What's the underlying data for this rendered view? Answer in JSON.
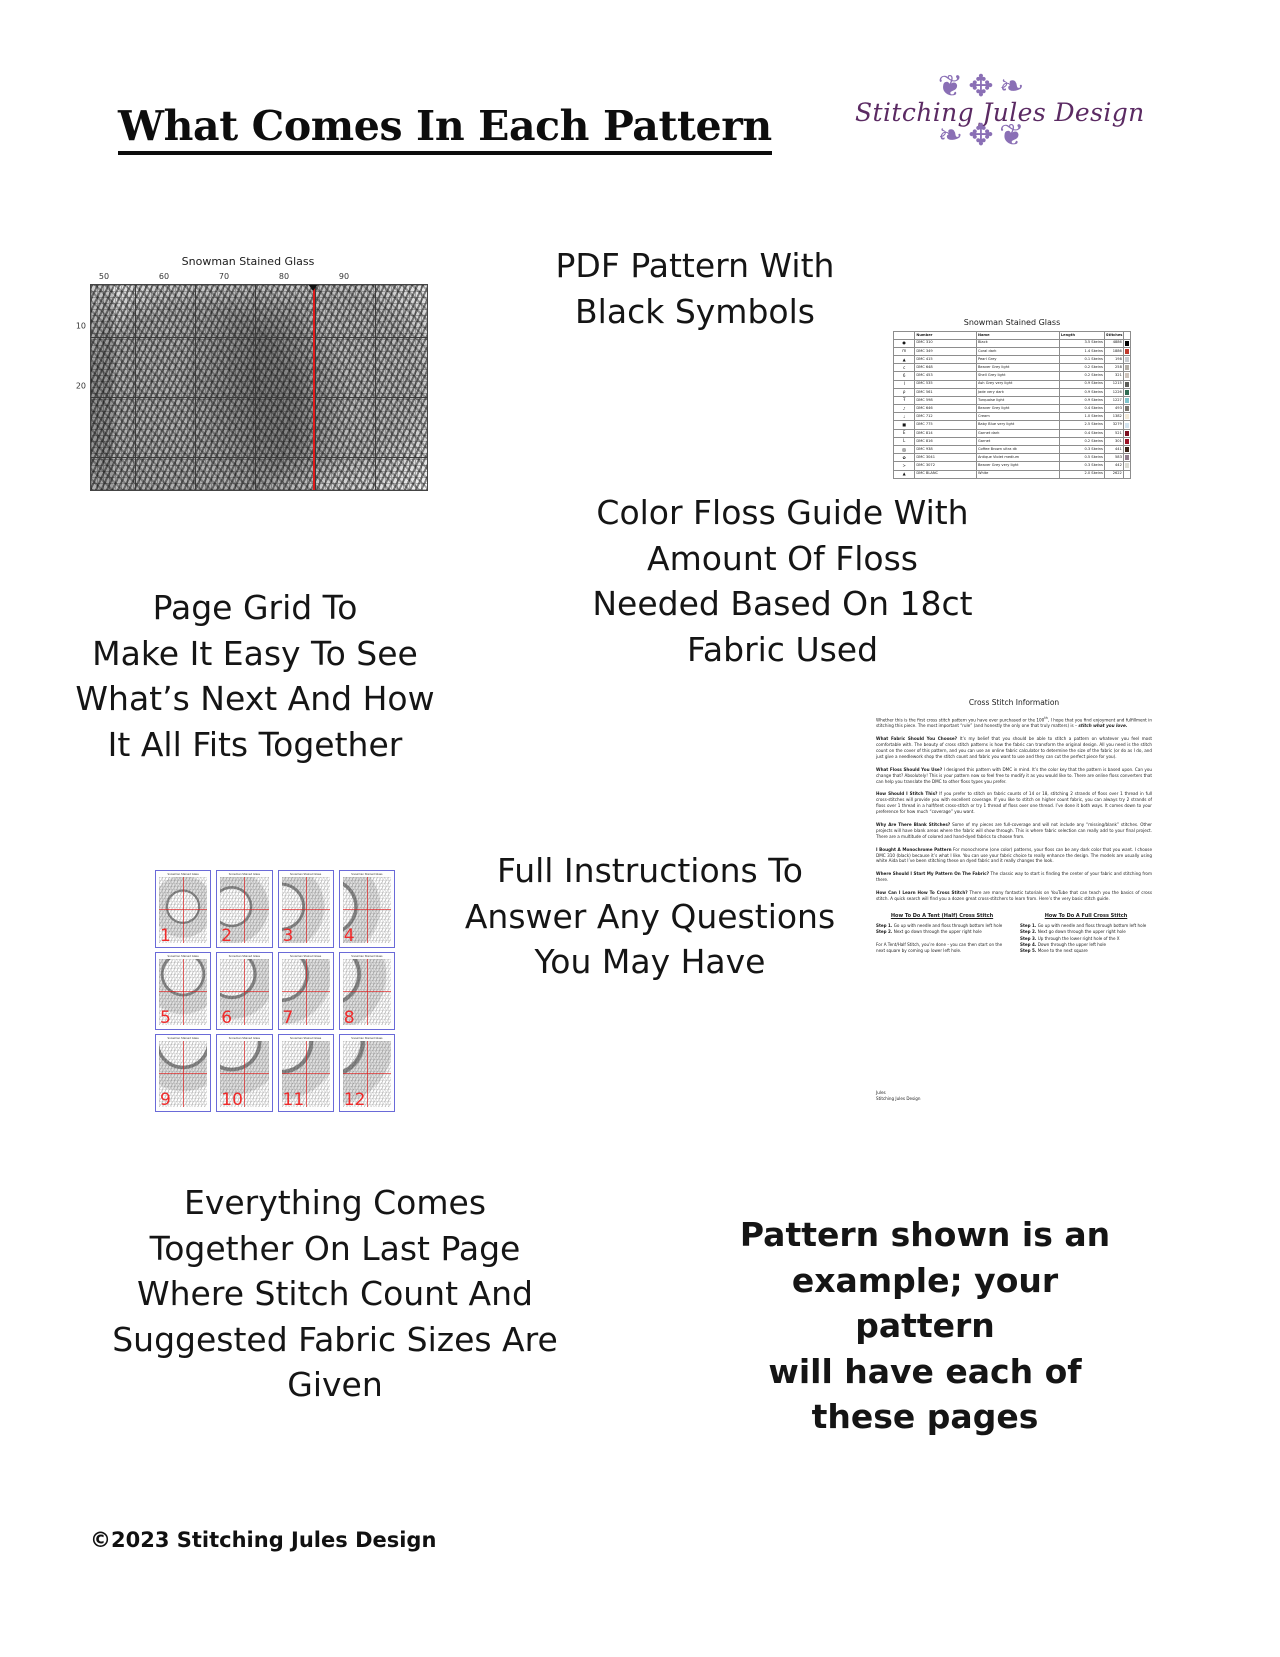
{
  "header": {
    "title": "What Comes In Each Pattern",
    "logo": {
      "brand": "Stitching Jules Design",
      "flourish_top": "❦ ✥ ❧",
      "flourish_bottom": "❧ ✥ ❦",
      "accent_color": "#8a6fb5",
      "text_color": "#5b2a63"
    }
  },
  "blurbs": {
    "pdf_pattern": "PDF Pattern With\nBlack Symbols",
    "page_grid": "Page Grid To\nMake It Easy To See\nWhat’s Next And How\nIt All Fits Together",
    "color_floss": "Color Floss Guide With\nAmount Of Floss\nNeeded Based On 18ct\nFabric Used",
    "full_instructions": "Full Instructions To\nAnswer Any Questions\nYou May Have",
    "everything_comes": "Everything Comes\nTogether On Last Page\nWhere Stitch Count And\nSuggested Fabric Sizes Are\nGiven",
    "example_note": "Pattern shown is an\nexample; your pattern\nwill have each of\nthese pages"
  },
  "footer": {
    "copyright": "©2023 Stitching Jules Design"
  },
  "chart_data": {
    "type": "heatmap",
    "title": "Snowman Stained Glass",
    "xlabel": "",
    "ylabel": "",
    "x_ticks": [
      50,
      60,
      70,
      80,
      90
    ],
    "y_ticks": [
      10,
      20
    ],
    "grid": true,
    "centerline_color": "#e01b1b",
    "centerline_x": 80,
    "description": "Cross stitch chart grid of black symbols on white squares with heavy grid lines every 10 stitches and a red vertical center guideline marked by a black arrow at column 80."
  },
  "floss_guide": {
    "title": "Snowman Stained Glass",
    "columns": [
      "",
      "Number",
      "Name",
      "Length",
      "Stitches",
      ""
    ],
    "rows": [
      {
        "symbol": "●",
        "number": "DMC   310",
        "name": "Black",
        "length": "3.5 Skeins",
        "stitches": "4886",
        "swatch": "#000000"
      },
      {
        "symbol": "m",
        "number": "DMC   349",
        "name": "Coral dark",
        "length": "1.4 Skeins",
        "stitches": "1886",
        "swatch": "#c0392b"
      },
      {
        "symbol": "▲",
        "number": "DMC   415",
        "name": "Pearl Grey",
        "length": "0.1 Skeins",
        "stitches": "198",
        "swatch": "#c9ccd0"
      },
      {
        "symbol": "c",
        "number": "DMC   648",
        "name": "Beaver Grey light",
        "length": "0.2 Skeins",
        "stitches": "258",
        "swatch": "#b4aea6"
      },
      {
        "symbol": "6",
        "number": "DMC   453",
        "name": "Shell Grey light",
        "length": "0.2 Skeins",
        "stitches": "321",
        "swatch": "#cdc3bb"
      },
      {
        "symbol": "I",
        "number": "DMC   535",
        "name": "Ash Grey very light",
        "length": "0.9 Skeins",
        "stitches": "1215",
        "swatch": "#5c5d58"
      },
      {
        "symbol": "ρ",
        "number": "DMC   561",
        "name": "Jade very dark",
        "length": "0.9 Skeins",
        "stitches": "1226",
        "swatch": "#2f6b52"
      },
      {
        "symbol": "Ŧ",
        "number": "DMC   598",
        "name": "Turquoise light",
        "length": "0.9 Skeins",
        "stitches": "1227",
        "swatch": "#7fc5cd"
      },
      {
        "symbol": "♪",
        "number": "DMC   646",
        "name": "Beaver Grey light",
        "length": "0.4 Skeins",
        "stitches": "493",
        "swatch": "#7a766e"
      },
      {
        "symbol": "♩",
        "number": "DMC   712",
        "name": "Cream",
        "length": "1.0 Skeins",
        "stitches": "1382",
        "swatch": "#f3ead8"
      },
      {
        "symbol": "■",
        "number": "DMC   775",
        "name": "Baby Blue very light",
        "length": "2.5 Skeins",
        "stitches": "3279",
        "swatch": "#d3e4f0"
      },
      {
        "symbol": "E",
        "number": "DMC   814",
        "name": "Garnet dark",
        "length": "0.4 Skeins",
        "stitches": "521",
        "swatch": "#7c0d1e"
      },
      {
        "symbol": "L",
        "number": "DMC   816",
        "name": "Garnet",
        "length": "0.2 Skeins",
        "stitches": "301",
        "swatch": "#9b1024"
      },
      {
        "symbol": "▨",
        "number": "DMC   938",
        "name": "Coffee Brown ultra dk",
        "length": "0.3 Skeins",
        "stitches": "441",
        "swatch": "#3b2418"
      },
      {
        "symbol": "✿",
        "number": "DMC   3041",
        "name": "Antique Violet medium",
        "length": "0.5 Skeins",
        "stitches": "583",
        "swatch": "#8f7c8c"
      },
      {
        "symbol": ">",
        "number": "DMC   3072",
        "name": "Beaver Grey very light",
        "length": "0.3 Skeins",
        "stitches": "442",
        "swatch": "#dcdcd4"
      },
      {
        "symbol": "▲",
        "number": "DMC   BLANC",
        "name": "White",
        "length": "2.0 Skeins",
        "stitches": "2622",
        "swatch": "#ffffff"
      }
    ]
  },
  "page_grid": {
    "thumbnail_title": "Snowman Stained Glass",
    "thumbnails": [
      {
        "number": "1"
      },
      {
        "number": "2"
      },
      {
        "number": "3"
      },
      {
        "number": "4"
      },
      {
        "number": "5"
      },
      {
        "number": "6"
      },
      {
        "number": "7"
      },
      {
        "number": "8"
      },
      {
        "number": "9"
      },
      {
        "number": "10"
      },
      {
        "number": "11"
      },
      {
        "number": "12"
      }
    ],
    "border_color": "#6a6ad8",
    "number_color": "#ef2b2b"
  },
  "instructions": {
    "title": "Cross Stitch Information",
    "intro_lead": "Whether this is the first cross stitch pattern you have ever purchased or the 100",
    "intro_rest": ", I hope that you find enjoyment and fulfillment in stitching this piece. The most important “rule” (and honestly the only one that truly matters) is – ",
    "intro_emphasis": "stitch what you love.",
    "sections": [
      {
        "heading": "What Fabric Should You Choose?",
        "body": " It’s my belief that you should be able to stitch a pattern on whatever you feel most comfortable with. The beauty of cross stitch patterns is how the fabric can transform the original design. All you need is the stitch count on the cover of this pattern, and you can use an online fabric calculator to determine the size of the fabric (or do as I do, and just give a needlework shop the stitch count and fabric you want to use and they can cut the perfect piece for you)."
      },
      {
        "heading": "What Floss Should You Use?",
        "body": " I designed this pattern with DMC in mind. It’s the color key that the pattern is based upon. Can you change that? Absolutely! This is your pattern now so feel free to modify it as you would like to.  There are online floss converters that can help you translate the DMC to other floss types you prefer."
      },
      {
        "heading": "How Should I Stitch This?",
        "body": " If you prefer to stitch on fabric counts of 14 or 18, stitching 2 strands of floss over 1 thread in full cross-stitches will provide you with excellent coverage. If you like to stitch on higher count fabric, you can always try 2 strands of floss over 1 thread in a half/tent cross-stitch or try 1 thread of floss over one thread. I’ve done it both ways. It comes down to your preference for how much “coverage” you want."
      },
      {
        "heading": "Why Are There Blank Stitches?",
        "body": " Some of my pieces are full-coverage and will not include any “missing/blank” stitches. Other projects will have blank areas where the fabric will show through. This is where fabric selection can really add to your final project. There are a multitude of colored and hand-dyed fabrics to choose from."
      },
      {
        "heading": "I Bought A Monochrome Pattern",
        "body": " For monochrome (one color) patterns, your floss can be any dark color that you want. I choose DMC 310 (black) because it’s what I like. You can use your fabric choice to really enhance the design. The models are usually using white Aida but I’ve been stitching these on dyed fabric and it really changes the look."
      },
      {
        "heading": "Where Should I Start My Pattern On The Fabric?",
        "body": " The classic way to start is finding the center of your fabric and stitching from there."
      },
      {
        "heading": "How Can I Learn How To Cross Stitch?",
        "body": " There are many fantastic tutorials on YouTube that can teach you the basics of cross stitch. A quick search will find you a dozen great cross-stitchers to learn from. Here’s the very basic stitch guide."
      }
    ],
    "tent_stitch": {
      "heading": "How To Do A Tent (Half) Cross Stitch",
      "steps": [
        "Step 1. Go up with needle and floss through bottom left hole",
        "Step 2. Next go down through the upper right hole"
      ],
      "note": "For A Tent/Half Stitch, you’re done - you can then start on the next square by coming up lower left hole."
    },
    "full_stitch": {
      "heading": "How To Do A Full Cross Stitch",
      "steps": [
        "Step 1. Go up with needle and floss through bottom left hole",
        "Step 2. Next go down through the upper right hole",
        "Step 3. Up through the lower right hole of the X",
        "Step 4. Down through the upper left hole",
        "Step 5. Move to the next square"
      ]
    },
    "signature": "Jules\nStitching Jules Design"
  }
}
